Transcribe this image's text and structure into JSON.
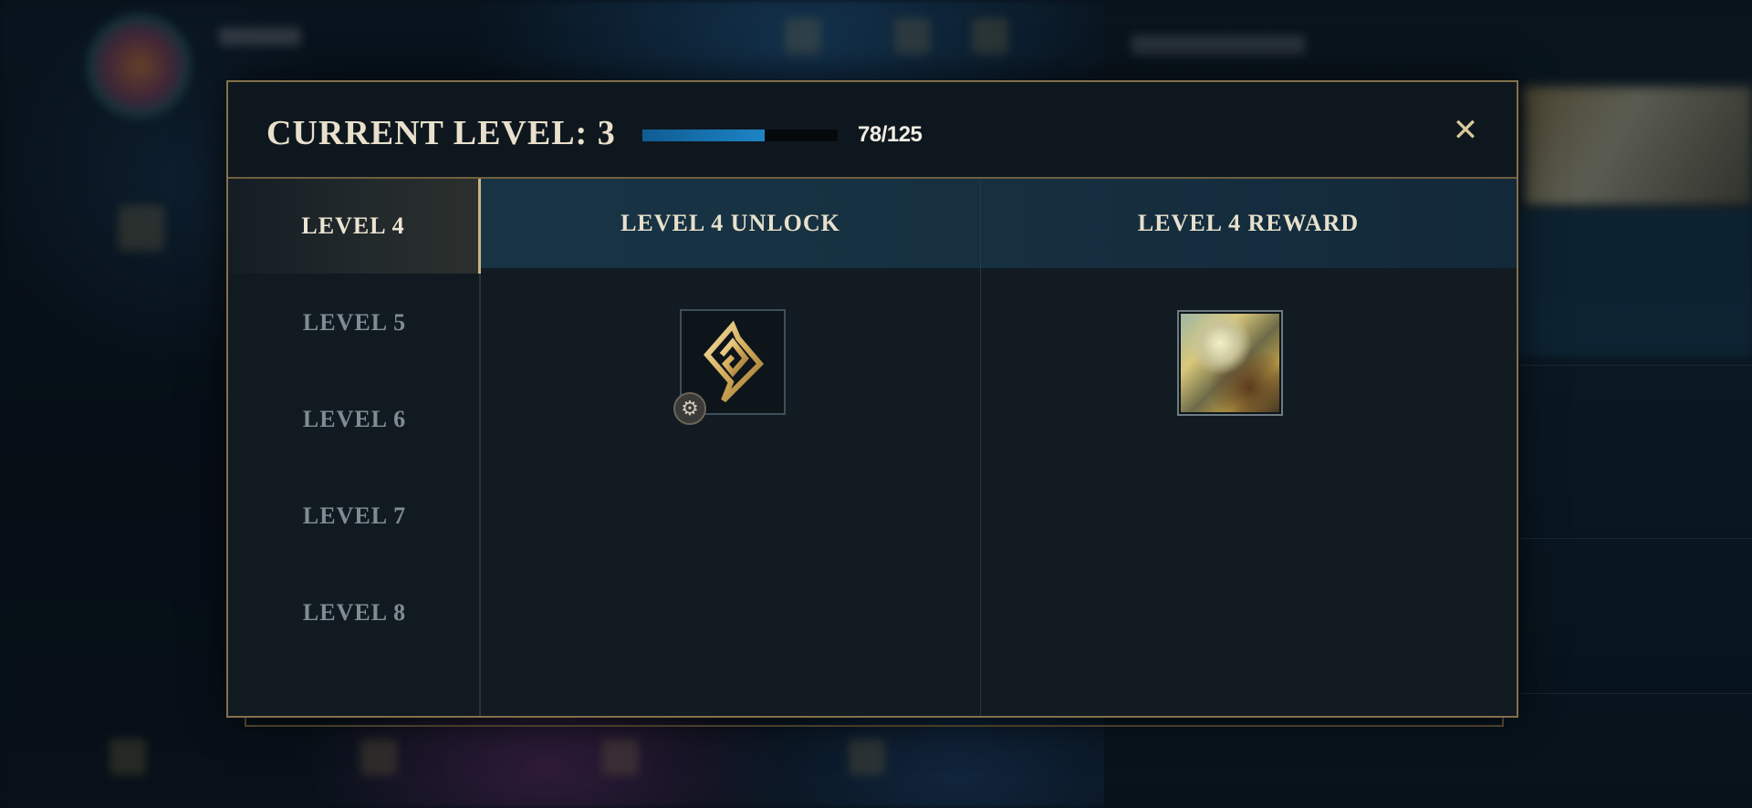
{
  "modal": {
    "title": "CURRENT LEVEL: 3",
    "progress": {
      "current": 78,
      "max": 125,
      "label": "78/125",
      "fraction": 0.624
    },
    "close_icon": "✕"
  },
  "sidebar": {
    "items": [
      {
        "label": "LEVEL 4",
        "active": true
      },
      {
        "label": "LEVEL 5",
        "active": false
      },
      {
        "label": "LEVEL 6",
        "active": false
      },
      {
        "label": "LEVEL 7",
        "active": false
      },
      {
        "label": "LEVEL 8",
        "active": false
      }
    ]
  },
  "content": {
    "unlock_header": "LEVEL 4 UNLOCK",
    "reward_header": "LEVEL 4 REWARD",
    "unlock_icon": "spiral-emblem-icon",
    "unlock_badge_icon": "gear-icon",
    "reward_icon": "champion-skin-icon"
  },
  "colors": {
    "accent_gold": "#c8b488",
    "progress_blue": "#1d84c6",
    "header_teal": "#173140"
  }
}
